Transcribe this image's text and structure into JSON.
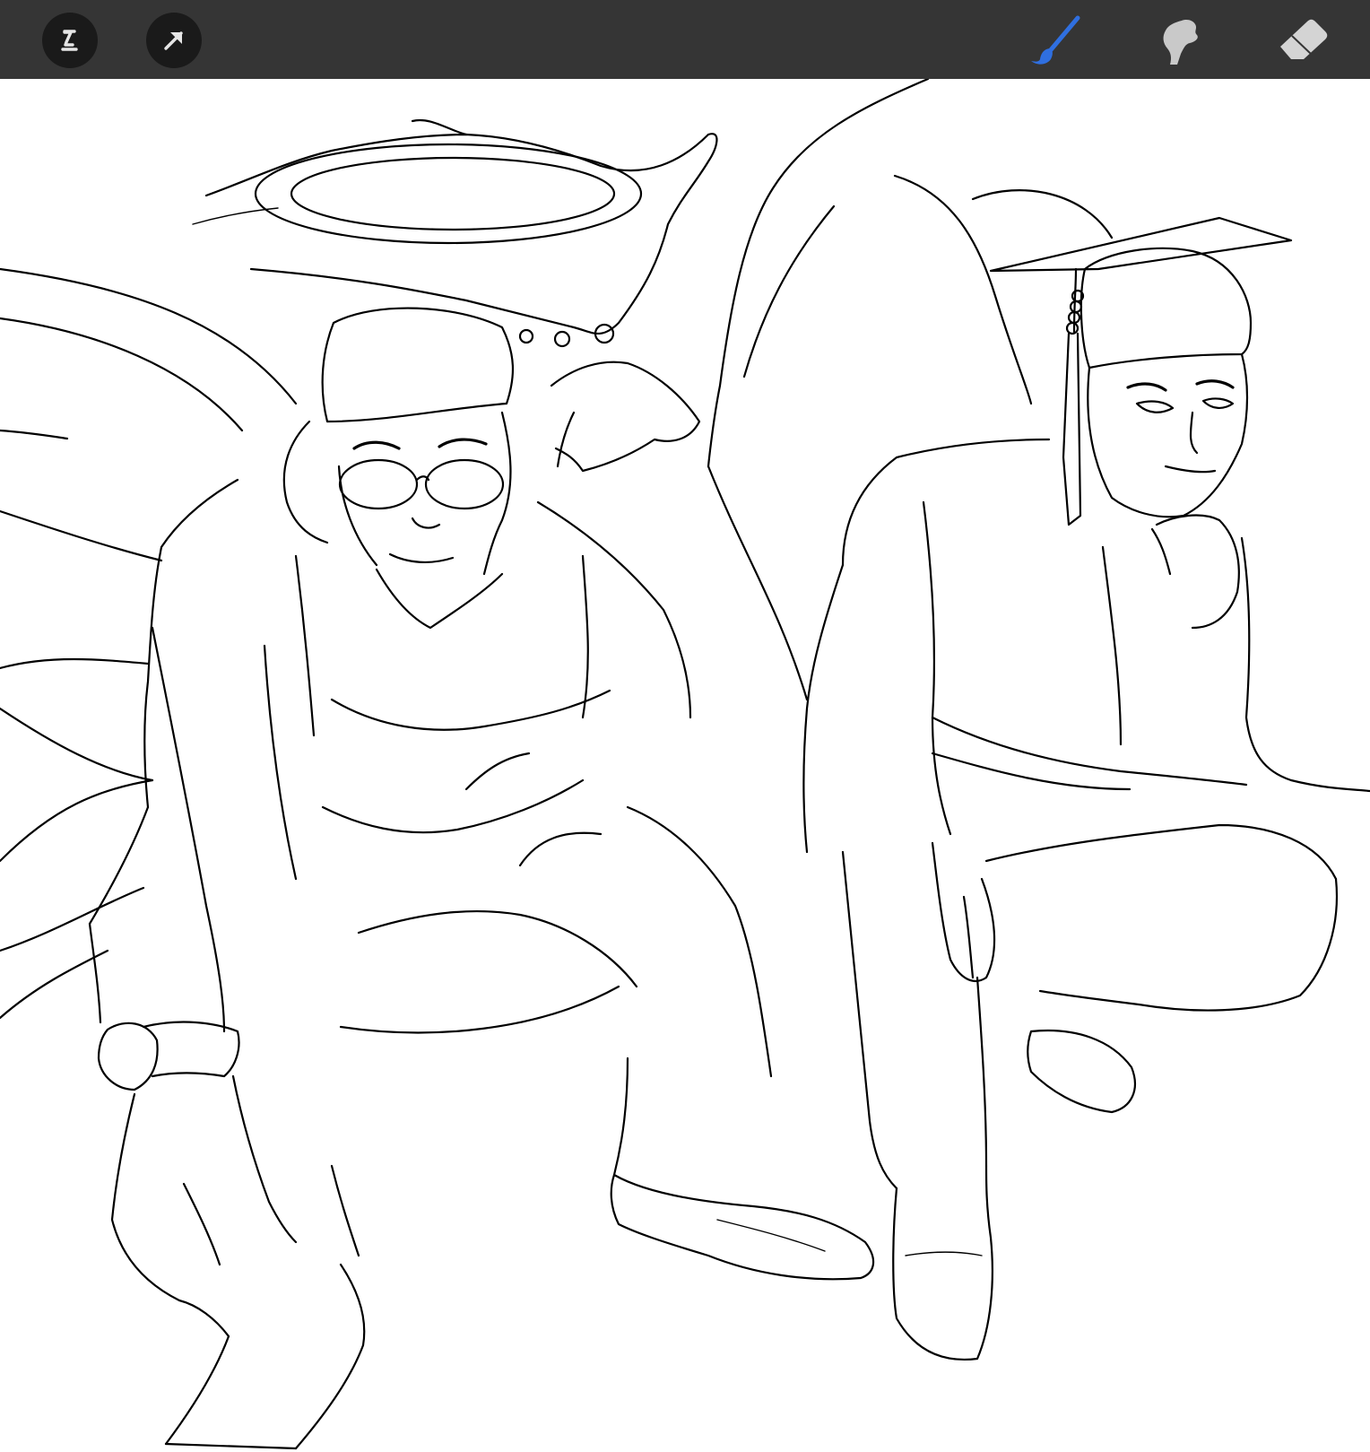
{
  "app": {
    "toolbar": {
      "background": "#353535",
      "left_tools": [
        {
          "name": "selection",
          "icon": "selection-icon"
        },
        {
          "name": "transform",
          "icon": "transform-arrow-icon"
        }
      ],
      "right_tools": [
        {
          "name": "brush",
          "icon": "brush-icon",
          "active": true,
          "color": "#2f6fe0"
        },
        {
          "name": "smudge",
          "icon": "smudge-icon",
          "active": false,
          "color": "#c8c8c8"
        },
        {
          "name": "eraser",
          "icon": "eraser-icon",
          "active": false,
          "color": "#c8c8c8"
        }
      ]
    },
    "canvas": {
      "background": "#ffffff",
      "ink_color": "#000000",
      "artwork": "line-art"
    }
  }
}
